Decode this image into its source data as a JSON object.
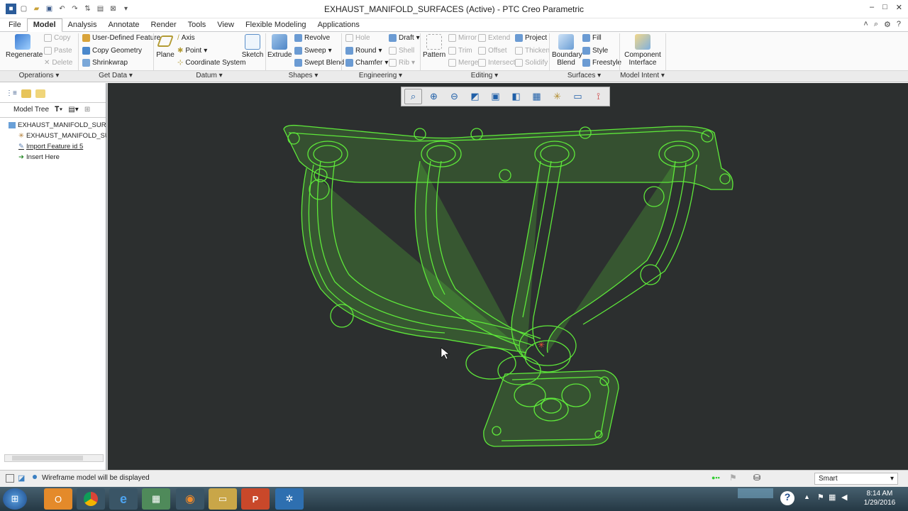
{
  "window": {
    "title": "EXHAUST_MANIFOLD_SURFACES (Active) - PTC Creo Parametric",
    "controls": [
      "–",
      "□",
      "✕"
    ]
  },
  "tabs": [
    "File",
    "Model",
    "Analysis",
    "Annotate",
    "Render",
    "Tools",
    "View",
    "Flexible Modeling",
    "Applications"
  ],
  "active_tab": "Model",
  "ribbon": {
    "operations": {
      "regenerate": "Regenerate",
      "copy": "Copy",
      "paste": "Paste",
      "delete": "Delete"
    },
    "get_data": {
      "udf": "User-Defined Feature",
      "copy_geometry": "Copy Geometry",
      "shrinkwrap": "Shrinkwrap"
    },
    "datum": {
      "plane": "Plane",
      "axis": "Axis",
      "point": "Point",
      "csys": "Coordinate System"
    },
    "shapes": {
      "sketch": "Sketch",
      "extrude": "Extrude",
      "revolve": "Revolve",
      "sweep": "Sweep",
      "swept_blend": "Swept Blend"
    },
    "engineering": {
      "hole": "Hole",
      "round": "Round",
      "chamfer": "Chamfer",
      "draft": "Draft",
      "shell": "Shell",
      "rib": "Rib"
    },
    "editing": {
      "pattern": "Pattern",
      "mirror": "Mirror",
      "trim": "Trim",
      "merge": "Merge",
      "extend": "Extend",
      "offset": "Offset",
      "intersect": "Intersect",
      "project": "Project",
      "thicken": "Thicken",
      "solidify": "Solidify"
    },
    "surfaces": {
      "boundary_blend_1": "Boundary",
      "boundary_blend_2": "Blend",
      "fill": "Fill",
      "style": "Style",
      "freestyle": "Freestyle"
    },
    "model_intent": {
      "comp_iface_1": "Component",
      "comp_iface_2": "Interface"
    }
  },
  "groups": [
    "Operations",
    "Get Data",
    "Datum",
    "Shapes",
    "Engineering",
    "Editing",
    "Surfaces",
    "Model Intent"
  ],
  "left_panel": {
    "header": "Model Tree",
    "tree": [
      "EXHAUST_MANIFOLD_SURFA",
      "EXHAUST_MANIFOLD_SUR",
      "Import Feature id 5",
      "Insert Here"
    ]
  },
  "status": {
    "message": "Wireframe model will be displayed",
    "filter": "Smart"
  },
  "taskbar": {
    "time": "8:14 AM",
    "date": "1/29/2016"
  },
  "colors": {
    "wire": "#5ee83a",
    "viewport_bg": "#2c2f2f",
    "accent": "#1f5fa8"
  }
}
